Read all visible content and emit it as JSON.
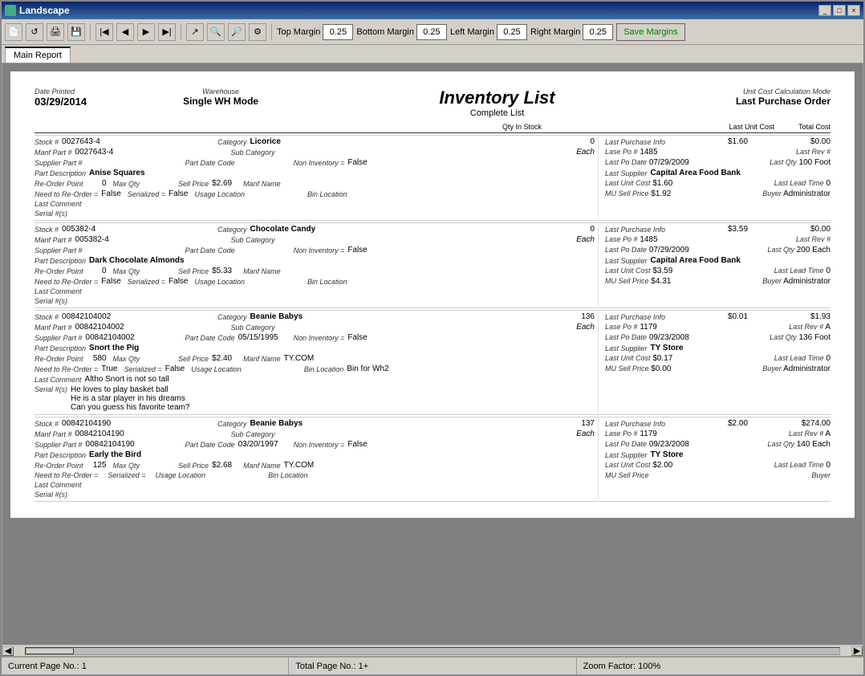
{
  "window": {
    "title": "Landscape",
    "controls": [
      "_",
      "□",
      "×"
    ]
  },
  "toolbar": {
    "top_margin_label": "Top Margin",
    "top_margin_value": "0.25",
    "bottom_margin_label": "Bottom Margin",
    "bottom_margin_value": "0.25",
    "left_margin_label": "Left Margin",
    "left_margin_value": "0.25",
    "right_margin_label": "Right Margin",
    "right_margin_value": "0.25",
    "save_margins_label": "Save Margins"
  },
  "tabs": [
    {
      "label": "Main Report",
      "active": true
    }
  ],
  "report": {
    "title": "Inventory List",
    "date_printed_label": "Date Printed",
    "date_printed": "03/29/2014",
    "warehouse_label": "Warehouse",
    "warehouse": "Single WH Mode",
    "subtitle": "Complete List",
    "unit_cost_label": "Unit Cost Calculation Mode",
    "unit_cost_mode": "Last Purchase Order",
    "col_headers": {
      "qty_in_stock": "Qty In Stock",
      "last_unit_cost": "Last Unit Cost",
      "total_cost": "Total Cost"
    }
  },
  "items": [
    {
      "stock_num": "0027643-4",
      "category": "Licorice",
      "qty": "0",
      "manf_part": "0027643-4",
      "sub_category": "",
      "unit": "Each",
      "supplier_part": "",
      "part_date_code": "",
      "non_inventory": "False",
      "part_description": "Anise Squares",
      "reorder_point": "0",
      "max_qty": "",
      "sell_price": "$2.69",
      "manf_name": "",
      "need_to_reorder": "False",
      "serialized": "False",
      "usage_location": "",
      "bin_location": "",
      "last_comment": "",
      "serial_numbers": "",
      "lpi": {
        "title": "Last Purchase Info",
        "unit_cost": "$1.60",
        "total_cost": "$0.00",
        "last_po_num": "1485",
        "last_rev": "",
        "last_po_date": "07/29/2009",
        "last_qty": "100",
        "last_qty_unit": "Foot",
        "last_supplier": "Capital Area Food Bank",
        "last_unit_cost": "$1.60",
        "last_lead_time": "0",
        "mu_sell_price": "$1.92",
        "buyer": "Administrator"
      }
    },
    {
      "stock_num": "005382-4",
      "category": "Chocolate Candy",
      "qty": "0",
      "manf_part": "005382-4",
      "sub_category": "",
      "unit": "Each",
      "supplier_part": "",
      "part_date_code": "",
      "non_inventory": "False",
      "part_description": "Dark Chocolate Almonds",
      "reorder_point": "0",
      "max_qty": "",
      "sell_price": "$5.33",
      "manf_name": "",
      "need_to_reorder": "False",
      "serialized": "False",
      "usage_location": "",
      "bin_location": "",
      "last_comment": "",
      "serial_numbers": "",
      "lpi": {
        "title": "Last Purchase Info",
        "unit_cost": "$3.59",
        "total_cost": "$0.00",
        "last_po_num": "1485",
        "last_rev": "",
        "last_po_date": "07/29/2009",
        "last_qty": "200",
        "last_qty_unit": "Each",
        "last_supplier": "Capital Area Food Bank",
        "last_unit_cost": "$3.59",
        "last_lead_time": "0",
        "mu_sell_price": "$4.31",
        "buyer": "Administrator"
      }
    },
    {
      "stock_num": "00842104002",
      "category": "Beanie Babys",
      "qty": "136",
      "manf_part": "00842104002",
      "sub_category": "",
      "unit": "Each",
      "supplier_part": "00842104002",
      "part_date_code": "05/15/1995",
      "non_inventory": "False",
      "part_description": "Snort the Pig",
      "reorder_point": "580",
      "max_qty": "",
      "sell_price": "$2.40",
      "manf_name": "TY.COM",
      "need_to_reorder": "True",
      "serialized": "False",
      "usage_location": "",
      "bin_location": "Bin for Wh2",
      "last_comment": "Altho Snort is not so tall",
      "serial_numbers": "He loves to play basket ball\n    He is a star player in his dreams\n    Can you guess his favorite team?",
      "lpi": {
        "title": "Last Purchase Info",
        "unit_cost": "$0.01",
        "total_cost": "$1.93",
        "last_po_num": "1179",
        "last_rev": "A",
        "last_po_date": "09/23/2008",
        "last_qty": "136",
        "last_qty_unit": "Foot",
        "last_supplier": "TY Store",
        "last_unit_cost": "$0.17",
        "last_lead_time": "0",
        "mu_sell_price": "$0.00",
        "buyer": "Administrator"
      }
    },
    {
      "stock_num": "00842104190",
      "category": "Beanie Babys",
      "qty": "137",
      "manf_part": "00842104190",
      "sub_category": "",
      "unit": "Each",
      "supplier_part": "00842104190",
      "part_date_code": "03/20/1997",
      "non_inventory": "False",
      "part_description": "Early the Bird",
      "reorder_point": "125",
      "max_qty": "",
      "sell_price": "$2.68",
      "manf_name": "TY.COM",
      "need_to_reorder": "",
      "serialized": "",
      "usage_location": "",
      "bin_location": "",
      "last_comment": "",
      "serial_numbers": "",
      "lpi": {
        "title": "Last Purchase Info",
        "unit_cost": "$2.00",
        "total_cost": "$274.00",
        "last_po_num": "1179",
        "last_rev": "A",
        "last_po_date": "09/23/2008",
        "last_qty": "140",
        "last_qty_unit": "Each",
        "last_supplier": "TY Store",
        "last_unit_cost": "$2.00",
        "last_lead_time": "0",
        "mu_sell_price": "",
        "buyer": ""
      }
    }
  ],
  "status_bar": {
    "current_page": "Current Page No.: 1",
    "total_page": "Total Page No.: 1+",
    "zoom": "Zoom Factor: 100%"
  }
}
